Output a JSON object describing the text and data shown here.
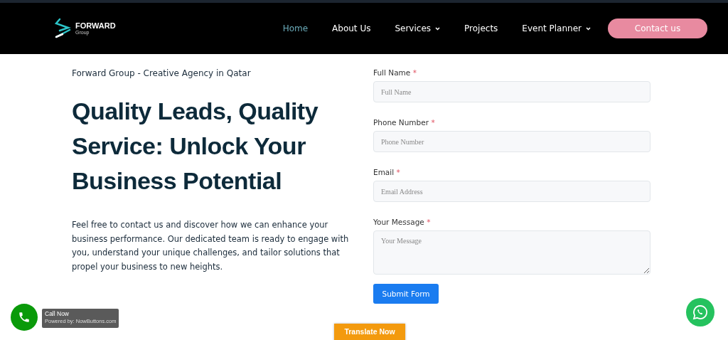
{
  "header": {
    "logo": {
      "name": "FORWARD",
      "sub": "Group"
    },
    "nav": [
      {
        "label": "Home",
        "selected": true,
        "dropdown": false
      },
      {
        "label": "About Us",
        "selected": false,
        "dropdown": false
      },
      {
        "label": "Services",
        "selected": false,
        "dropdown": true
      },
      {
        "label": "Projects",
        "selected": false,
        "dropdown": false
      },
      {
        "label": "Event Planner",
        "selected": false,
        "dropdown": true
      }
    ],
    "cta": "Contact us"
  },
  "hero": {
    "tagline": "Forward Group - Creative Agency in Qatar",
    "heading": "Quality Leads, Quality Service: Unlock Your Business Potential",
    "body": "Feel free to contact us and discover how we can enhance your business performance. Our dedicated team is ready to engage with you, understand your unique challenges, and tailor solutions that propel your business to new heights."
  },
  "form": {
    "fields": [
      {
        "kind": "input",
        "label": "Full Name",
        "mark": "*",
        "placeholder": "Full Name"
      },
      {
        "kind": "input",
        "label": "Phone Number",
        "mark": "*",
        "placeholder": "Phone Number"
      },
      {
        "kind": "input",
        "label": "Email",
        "mark": "*",
        "placeholder": "Email Address"
      },
      {
        "kind": "textarea",
        "label": "Your Message",
        "mark": "*",
        "placeholder": "Your Message"
      }
    ],
    "submit": "Submit Form"
  },
  "call_widget": {
    "label": "Call Now",
    "powered": "Powered by: NowButtons.com"
  },
  "translate": "Translate Now"
}
